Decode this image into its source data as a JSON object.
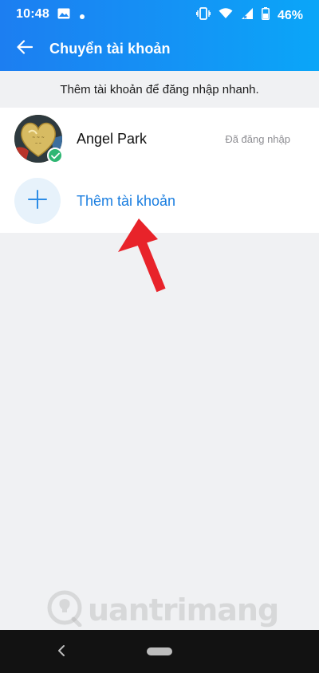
{
  "status_bar": {
    "time": "10:48",
    "battery": "46%",
    "icons": [
      "image-icon",
      "dot-icon",
      "vibrate-icon",
      "wifi-icon",
      "signal-icon",
      "battery-icon"
    ]
  },
  "app_bar": {
    "title": "Chuyển tài khoản",
    "back_icon": "arrow-left-icon"
  },
  "hint": "Thêm tài khoản để đăng nhập nhanh.",
  "accounts": [
    {
      "name": "Angel Park",
      "status": "Đã đăng nhập",
      "active": true
    }
  ],
  "add_account": {
    "label": "Thêm tài khoản",
    "icon": "plus-icon"
  },
  "watermark": {
    "text": "uantrimang"
  },
  "colors": {
    "header_start": "#1c7ef1",
    "header_end": "#0aa6f8",
    "link_blue": "#1a7ee0",
    "check_green": "#2fb673",
    "annotation_red": "#e8232a",
    "background": "#f0f1f3"
  }
}
